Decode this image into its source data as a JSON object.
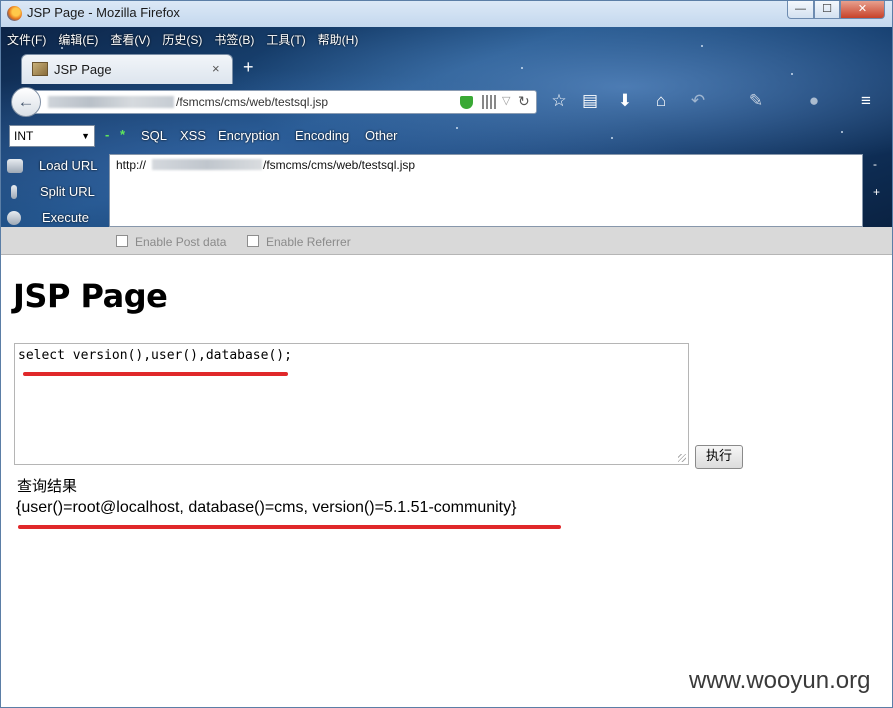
{
  "window": {
    "title": "JSP Page - Mozilla Firefox",
    "min_glyph": "—",
    "max_glyph": "☐",
    "close_glyph": "✕"
  },
  "menubar": [
    "文件(F)",
    "编辑(E)",
    "查看(V)",
    "历史(S)",
    "书签(B)",
    "工具(T)",
    "帮助(H)"
  ],
  "tab": {
    "label": "JSP Page",
    "close_glyph": "×",
    "new_tab_glyph": "+"
  },
  "navbar": {
    "back_glyph": "←",
    "url_visible": "/fsmcms/cms/web/testsql.jsp",
    "dropdown_glyph": "▽",
    "reload_glyph": "↻",
    "icons": [
      "bookmark-star-icon",
      "reading-list-icon",
      "download-icon",
      "home-icon",
      "undo-icon",
      "addon-icon",
      "persona-icon",
      "menu-icon"
    ]
  },
  "hackbar": {
    "select_value": "INT",
    "select_arrow": "▼",
    "minus": "-",
    "star": "*",
    "menus": [
      "SQL",
      "XSS",
      "Encryption",
      "Encoding",
      "Other"
    ],
    "actions": [
      "Load URL",
      "Split URL",
      "Execute"
    ],
    "url_prefix": "http://",
    "url_rest": "/fsmcms/cms/web/testsql.jsp",
    "side_minus": "-",
    "side_plus": "+",
    "enable_post": "Enable Post data",
    "enable_referrer": "Enable Referrer"
  },
  "page": {
    "heading": "JSP Page",
    "sql_value": "select version(),user(),database();",
    "exec_label": "执行",
    "result_label": "查询结果",
    "result_value": "{user()=root@localhost, database()=cms, version()=5.1.51-community}"
  },
  "watermark": "www.wooyun.org",
  "colors": {
    "underline_red": "#e0282a",
    "chrome_dark": "#0c2447"
  }
}
